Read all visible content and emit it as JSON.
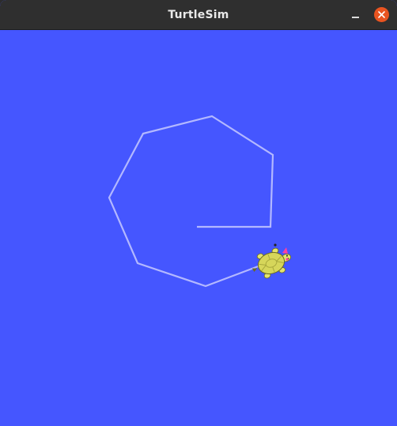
{
  "window": {
    "title": "TurtleSim",
    "minimize_icon": "minimize-icon",
    "close_icon": "close-icon"
  },
  "canvas": {
    "background_color": "#4556ff",
    "pen_color": "#b3b8ff"
  },
  "turtle": {
    "icon": "turtle-icon",
    "shell_color": "#d6d65a",
    "shell_pattern_color": "#a9a93c",
    "limb_color": "#e3e36f",
    "tail_color": "#ff3fa0"
  }
}
